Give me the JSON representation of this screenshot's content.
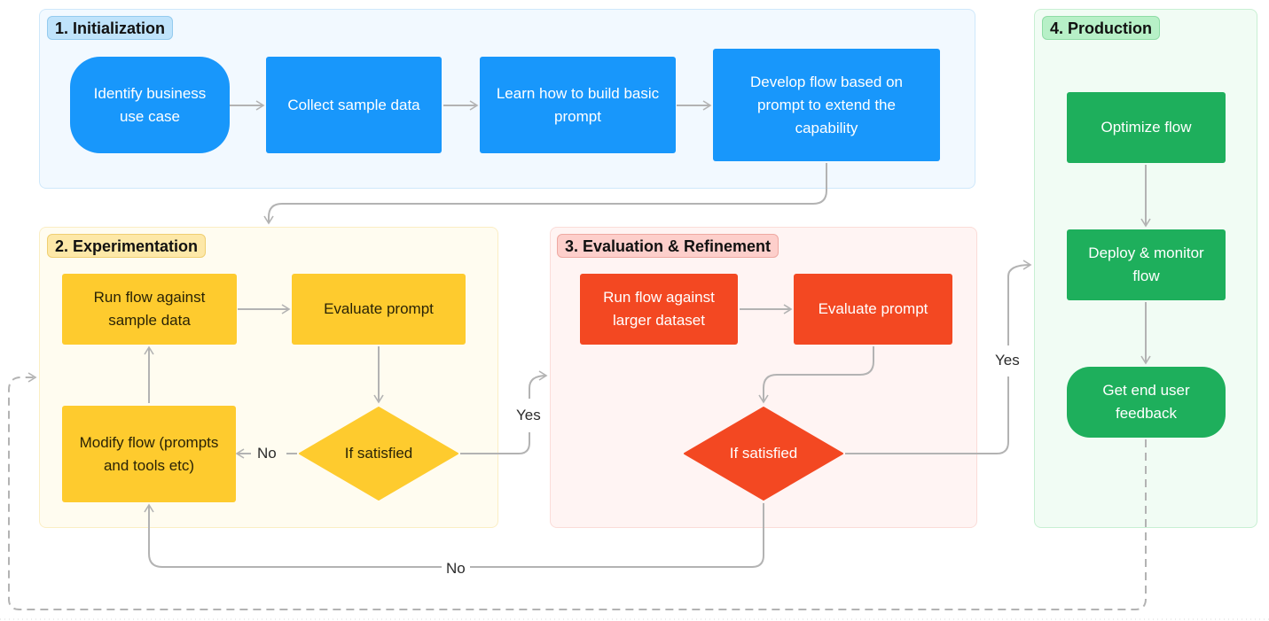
{
  "groups": {
    "initialization": {
      "title": "1. Initialization"
    },
    "experimentation": {
      "title": "2. Experimentation"
    },
    "evaluation": {
      "title": "3. Evaluation & Refinement"
    },
    "production": {
      "title": "4. Production"
    }
  },
  "nodes": {
    "identify": "Identify business use case",
    "collect": "Collect sample data",
    "learn": "Learn how to build basic prompt",
    "develop": "Develop flow based on prompt to extend the capability",
    "run_sample": "Run flow against sample data",
    "evaluate_exp": "Evaluate prompt",
    "modify": "Modify flow (prompts and tools etc)",
    "satisfied_exp": "If satisfied",
    "run_large": "Run flow against larger dataset",
    "evaluate_eval": "Evaluate prompt",
    "satisfied_eval": "If satisfied",
    "optimize": "Optimize flow",
    "deploy": "Deploy & monitor flow",
    "feedback": "Get end user feedback"
  },
  "edge_labels": {
    "exp_no": "No",
    "exp_yes": "Yes",
    "eval_yes": "Yes",
    "eval_no": "No"
  },
  "colors": {
    "initialization": "#1897fb",
    "experimentation": "#fecb2e",
    "evaluation": "#f34822",
    "production": "#1eaf5c",
    "connector": "#b3b3b3"
  }
}
